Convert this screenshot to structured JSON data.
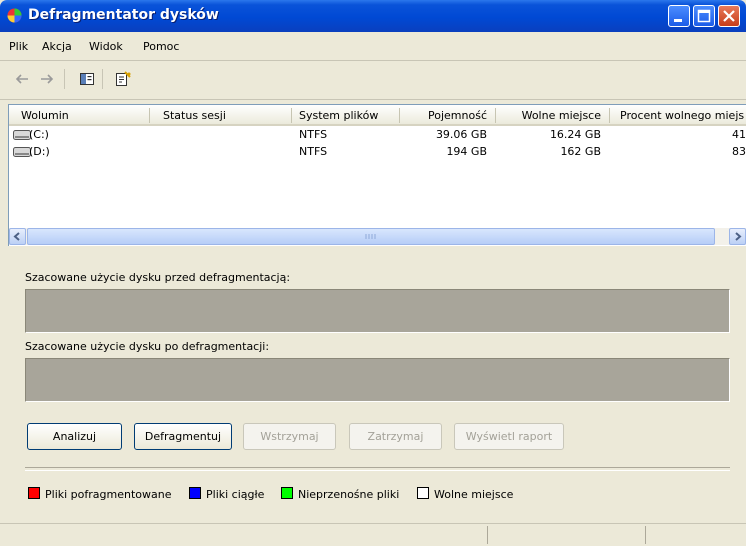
{
  "window": {
    "title": "Defragmentator dysków"
  },
  "menu": [
    "Plik",
    "Akcja",
    "Widok",
    "Pomoc"
  ],
  "toolbar": {
    "icons": [
      "back-arrow-icon",
      "forward-arrow-icon",
      "show-hide-console-tree-icon",
      "properties-icon"
    ]
  },
  "list": {
    "columns": [
      "Wolumin",
      "Status sesji",
      "System plików",
      "Pojemność",
      "Wolne miejsce",
      "Procent wolnego miejs"
    ],
    "rows": [
      {
        "volume": "(C:)",
        "status": "",
        "fs": "NTFS",
        "capacity": "39.06 GB",
        "free": "16.24 GB",
        "percent": "41"
      },
      {
        "volume": "(D:)",
        "status": "",
        "fs": "NTFS",
        "capacity": "194 GB",
        "free": "162 GB",
        "percent": "83"
      }
    ]
  },
  "labels": {
    "before": "Szacowane użycie dysku przed defragmentacją:",
    "after": "Szacowane użycie dysku po defragmentacji:"
  },
  "buttons": {
    "analyze": "Analizuj",
    "defragment": "Defragmentuj",
    "pause": "Wstrzymaj",
    "stop": "Zatrzymaj",
    "report": "Wyświetl raport"
  },
  "legend": [
    {
      "label": "Pliki pofragmentowane",
      "color": "#ff0000"
    },
    {
      "label": "Pliki ciągłe",
      "color": "#0000ff"
    },
    {
      "label": "Nieprzenośne pliki",
      "color": "#00ff00"
    },
    {
      "label": "Wolne miejsce",
      "color": "#ffffff"
    }
  ]
}
